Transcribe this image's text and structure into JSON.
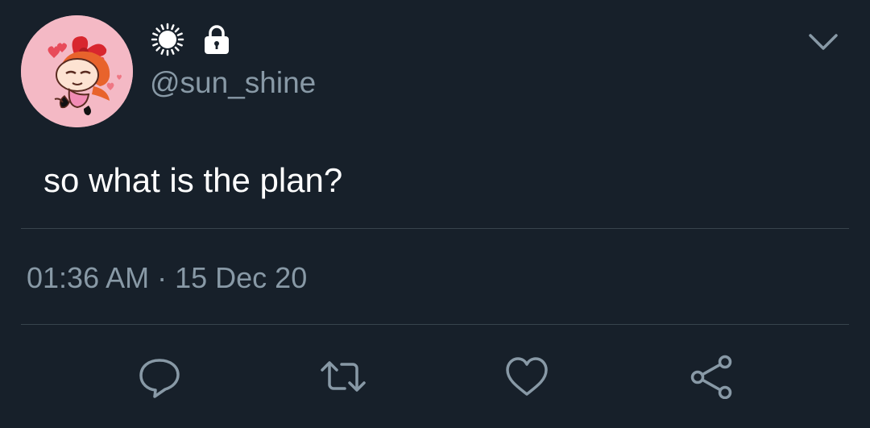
{
  "tweet": {
    "handle": "@sun_shine",
    "text": "so what is the plan?",
    "time": "01:36 AM",
    "separator": " · ",
    "date": "15 Dec 20"
  },
  "icons": {
    "name_emoji": "sun-icon",
    "protected": "lock-icon",
    "menu": "chevron-down-icon",
    "actions": [
      "reply-icon",
      "retweet-icon",
      "like-icon",
      "share-icon"
    ]
  },
  "colors": {
    "background": "#17202a",
    "secondary_text": "#8899a6",
    "divider": "#38444d",
    "avatar_background": "#f4b9c5"
  }
}
